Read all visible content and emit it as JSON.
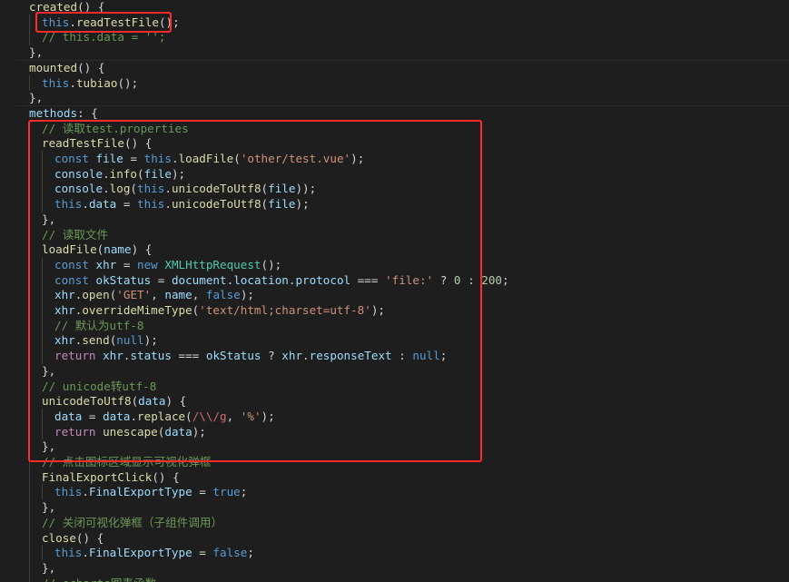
{
  "editor": {
    "language": "javascript",
    "theme_colors": {
      "background": "#1e1e1e",
      "highlight_box": "#ff2a2a",
      "keyword": "#569cd6",
      "function": "#dcdcaa",
      "string": "#ce9178",
      "comment": "#6a9955",
      "variable": "#9cdcfe"
    },
    "lines": [
      {
        "indent": 0,
        "tokens": [
          [
            "fn",
            "created"
          ],
          [
            "pun",
            "() {"
          ]
        ]
      },
      {
        "indent": 1,
        "tokens": [
          [
            "kw",
            "this"
          ],
          [
            "pun",
            "."
          ],
          [
            "fn",
            "readTestFile"
          ],
          [
            "pun",
            "();"
          ]
        ]
      },
      {
        "indent": 1,
        "tokens": [
          [
            "cmt",
            "// this.data = '';"
          ]
        ]
      },
      {
        "indent": 0,
        "tokens": [
          [
            "pun",
            "},"
          ]
        ]
      },
      {
        "indent": 0,
        "tokens": [
          [
            "fn",
            "mounted"
          ],
          [
            "pun",
            "() {"
          ]
        ]
      },
      {
        "indent": 1,
        "tokens": [
          [
            "kw",
            "this"
          ],
          [
            "pun",
            "."
          ],
          [
            "fn",
            "tubiao"
          ],
          [
            "pun",
            "();"
          ]
        ]
      },
      {
        "indent": 0,
        "tokens": [
          [
            "pun",
            "},"
          ]
        ]
      },
      {
        "indent": 0,
        "tokens": [
          [
            "prop",
            "methods"
          ],
          [
            "pun",
            ": {"
          ]
        ]
      },
      {
        "indent": 1,
        "tokens": [
          [
            "cmt",
            "// 读取test.properties"
          ]
        ]
      },
      {
        "indent": 1,
        "tokens": [
          [
            "fn",
            "readTestFile"
          ],
          [
            "pun",
            "() {"
          ]
        ]
      },
      {
        "indent": 2,
        "tokens": [
          [
            "kw",
            "const"
          ],
          [
            "pun",
            " "
          ],
          [
            "prop",
            "file"
          ],
          [
            "pun",
            " = "
          ],
          [
            "kw",
            "this"
          ],
          [
            "pun",
            "."
          ],
          [
            "fn",
            "loadFile"
          ],
          [
            "pun",
            "("
          ],
          [
            "str",
            "'other/test.vue'"
          ],
          [
            "pun",
            ");"
          ]
        ]
      },
      {
        "indent": 2,
        "tokens": [
          [
            "prop",
            "console"
          ],
          [
            "pun",
            "."
          ],
          [
            "fn",
            "info"
          ],
          [
            "pun",
            "("
          ],
          [
            "prop",
            "file"
          ],
          [
            "pun",
            ");"
          ]
        ]
      },
      {
        "indent": 2,
        "tokens": [
          [
            "prop",
            "console"
          ],
          [
            "pun",
            "."
          ],
          [
            "fn",
            "log"
          ],
          [
            "pun",
            "("
          ],
          [
            "kw",
            "this"
          ],
          [
            "pun",
            "."
          ],
          [
            "fn",
            "unicodeToUtf8"
          ],
          [
            "pun",
            "("
          ],
          [
            "prop",
            "file"
          ],
          [
            "pun",
            "));"
          ]
        ]
      },
      {
        "indent": 2,
        "tokens": [
          [
            "kw",
            "this"
          ],
          [
            "pun",
            "."
          ],
          [
            "prop",
            "data"
          ],
          [
            "pun",
            " = "
          ],
          [
            "kw",
            "this"
          ],
          [
            "pun",
            "."
          ],
          [
            "fn",
            "unicodeToUtf8"
          ],
          [
            "pun",
            "("
          ],
          [
            "prop",
            "file"
          ],
          [
            "pun",
            ");"
          ]
        ]
      },
      {
        "indent": 1,
        "tokens": [
          [
            "pun",
            "},"
          ]
        ]
      },
      {
        "indent": 1,
        "tokens": [
          [
            "cmt",
            "// 读取文件"
          ]
        ]
      },
      {
        "indent": 1,
        "tokens": [
          [
            "fn",
            "loadFile"
          ],
          [
            "pun",
            "("
          ],
          [
            "prop",
            "name"
          ],
          [
            "pun",
            ") {"
          ]
        ]
      },
      {
        "indent": 2,
        "tokens": [
          [
            "kw",
            "const"
          ],
          [
            "pun",
            " "
          ],
          [
            "prop",
            "xhr"
          ],
          [
            "pun",
            " = "
          ],
          [
            "kw",
            "new"
          ],
          [
            "pun",
            " "
          ],
          [
            "cls",
            "XMLHttpRequest"
          ],
          [
            "pun",
            "();"
          ]
        ]
      },
      {
        "indent": 2,
        "tokens": [
          [
            "kw",
            "const"
          ],
          [
            "pun",
            " "
          ],
          [
            "prop",
            "okStatus"
          ],
          [
            "pun",
            " = "
          ],
          [
            "prop",
            "document"
          ],
          [
            "pun",
            "."
          ],
          [
            "prop",
            "location"
          ],
          [
            "pun",
            "."
          ],
          [
            "prop",
            "protocol"
          ],
          [
            "pun",
            " === "
          ],
          [
            "str",
            "'file:'"
          ],
          [
            "pun",
            " ? "
          ],
          [
            "num",
            "0"
          ],
          [
            "pun",
            " : "
          ],
          [
            "num",
            "200"
          ],
          [
            "pun",
            ";"
          ]
        ]
      },
      {
        "indent": 2,
        "tokens": [
          [
            "prop",
            "xhr"
          ],
          [
            "pun",
            "."
          ],
          [
            "fn",
            "open"
          ],
          [
            "pun",
            "("
          ],
          [
            "str",
            "'GET'"
          ],
          [
            "pun",
            ", "
          ],
          [
            "prop",
            "name"
          ],
          [
            "pun",
            ", "
          ],
          [
            "kw",
            "false"
          ],
          [
            "pun",
            ");"
          ]
        ]
      },
      {
        "indent": 2,
        "tokens": [
          [
            "prop",
            "xhr"
          ],
          [
            "pun",
            "."
          ],
          [
            "fn",
            "overrideMimeType"
          ],
          [
            "pun",
            "("
          ],
          [
            "str",
            "'text/html;charset=utf-8'"
          ],
          [
            "pun",
            ");"
          ]
        ]
      },
      {
        "indent": 2,
        "tokens": [
          [
            "cmt",
            "// 默认为utf-8"
          ]
        ]
      },
      {
        "indent": 2,
        "tokens": [
          [
            "prop",
            "xhr"
          ],
          [
            "pun",
            "."
          ],
          [
            "fn",
            "send"
          ],
          [
            "pun",
            "("
          ],
          [
            "kw",
            "null"
          ],
          [
            "pun",
            ");"
          ]
        ]
      },
      {
        "indent": 2,
        "tokens": [
          [
            "ctrl",
            "return"
          ],
          [
            "pun",
            " "
          ],
          [
            "prop",
            "xhr"
          ],
          [
            "pun",
            "."
          ],
          [
            "prop",
            "status"
          ],
          [
            "pun",
            " === "
          ],
          [
            "prop",
            "okStatus"
          ],
          [
            "pun",
            " ? "
          ],
          [
            "prop",
            "xhr"
          ],
          [
            "pun",
            "."
          ],
          [
            "prop",
            "responseText"
          ],
          [
            "pun",
            " : "
          ],
          [
            "kw",
            "null"
          ],
          [
            "pun",
            ";"
          ]
        ]
      },
      {
        "indent": 1,
        "tokens": [
          [
            "pun",
            "},"
          ]
        ]
      },
      {
        "indent": 1,
        "tokens": [
          [
            "cmt",
            "// unicode转utf-8"
          ]
        ]
      },
      {
        "indent": 1,
        "tokens": [
          [
            "fn",
            "unicodeToUtf8"
          ],
          [
            "pun",
            "("
          ],
          [
            "prop",
            "data"
          ],
          [
            "pun",
            ") {"
          ]
        ]
      },
      {
        "indent": 2,
        "tokens": [
          [
            "prop",
            "data"
          ],
          [
            "pun",
            " = "
          ],
          [
            "prop",
            "data"
          ],
          [
            "pun",
            "."
          ],
          [
            "fn",
            "replace"
          ],
          [
            "pun",
            "("
          ],
          [
            "rx",
            "/\\\\/g"
          ],
          [
            "pun",
            ", "
          ],
          [
            "str",
            "'%'"
          ],
          [
            "pun",
            ");"
          ]
        ]
      },
      {
        "indent": 2,
        "tokens": [
          [
            "ctrl",
            "return"
          ],
          [
            "pun",
            " "
          ],
          [
            "fn",
            "unescape"
          ],
          [
            "pun",
            "("
          ],
          [
            "prop",
            "data"
          ],
          [
            "pun",
            ");"
          ]
        ]
      },
      {
        "indent": 1,
        "tokens": [
          [
            "pun",
            "},"
          ]
        ]
      },
      {
        "indent": 1,
        "tokens": [
          [
            "cmt",
            "// 点击图标区域显示可视化弹框"
          ]
        ]
      },
      {
        "indent": 1,
        "tokens": [
          [
            "fn",
            "FinalExportClick"
          ],
          [
            "pun",
            "() {"
          ]
        ]
      },
      {
        "indent": 2,
        "tokens": [
          [
            "kw",
            "this"
          ],
          [
            "pun",
            "."
          ],
          [
            "prop",
            "FinalExportType"
          ],
          [
            "pun",
            " = "
          ],
          [
            "kw",
            "true"
          ],
          [
            "pun",
            ";"
          ]
        ]
      },
      {
        "indent": 1,
        "tokens": [
          [
            "pun",
            "},"
          ]
        ]
      },
      {
        "indent": 1,
        "tokens": [
          [
            "cmt",
            "// 关闭可视化弹框（子组件调用）"
          ]
        ]
      },
      {
        "indent": 1,
        "tokens": [
          [
            "fn",
            "close"
          ],
          [
            "pun",
            "() {"
          ]
        ]
      },
      {
        "indent": 2,
        "tokens": [
          [
            "kw",
            "this"
          ],
          [
            "pun",
            "."
          ],
          [
            "prop",
            "FinalExportType"
          ],
          [
            "pun",
            " = "
          ],
          [
            "kw",
            "false"
          ],
          [
            "pun",
            ";"
          ]
        ]
      },
      {
        "indent": 1,
        "tokens": [
          [
            "pun",
            "},"
          ]
        ]
      },
      {
        "indent": 1,
        "tokens": [
          [
            "cmt",
            "// echarts图表函数"
          ]
        ]
      }
    ]
  }
}
